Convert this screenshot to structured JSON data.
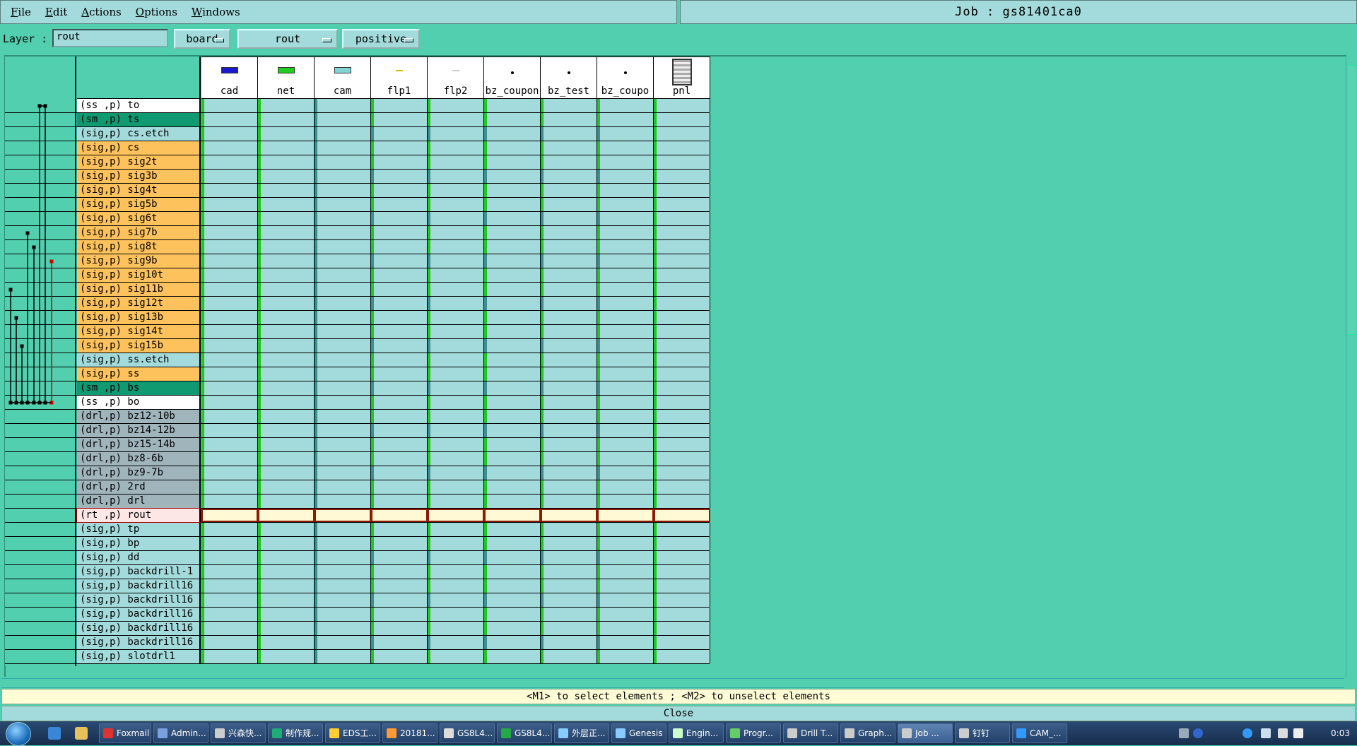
{
  "menu": [
    "File",
    "Edit",
    "Actions",
    "Options",
    "Windows"
  ],
  "job_title": "Job : gs81401ca0",
  "layer_label": "Layer :",
  "layer_value": "rout",
  "options": [
    "board",
    "rout",
    "positive"
  ],
  "steps": [
    "cad",
    "net",
    "cam",
    "flp1",
    "flp2",
    "bz_coupon",
    "bz_test",
    "bz_coupo",
    "pnl"
  ],
  "step_icon_colors": [
    "#1a1acc",
    "#22cc22",
    "#7fd4d4",
    "#d8c000",
    "#cccccc",
    "#000000",
    "#000000",
    "#000000",
    "#555555"
  ],
  "layers": [
    {
      "text": "(ss ,p) to",
      "color": "#ffffff"
    },
    {
      "text": "(sm ,p) ts",
      "color": "#0f9a72"
    },
    {
      "text": "(sig,p) cs.etch",
      "color": "#a3dadb"
    },
    {
      "text": "(sig,p) cs",
      "color": "#fec25c"
    },
    {
      "text": "(sig,p) sig2t",
      "color": "#fec25c"
    },
    {
      "text": "(sig,p) sig3b",
      "color": "#fec25c"
    },
    {
      "text": "(sig,p) sig4t",
      "color": "#fec25c"
    },
    {
      "text": "(sig,p) sig5b",
      "color": "#fec25c"
    },
    {
      "text": "(sig,p) sig6t",
      "color": "#fec25c"
    },
    {
      "text": "(sig,p) sig7b",
      "color": "#fec25c"
    },
    {
      "text": "(sig,p) sig8t",
      "color": "#fec25c"
    },
    {
      "text": "(sig,p) sig9b",
      "color": "#fec25c"
    },
    {
      "text": "(sig,p) sig10t",
      "color": "#fec25c"
    },
    {
      "text": "(sig,p) sig11b",
      "color": "#fec25c"
    },
    {
      "text": "(sig,p) sig12t",
      "color": "#fec25c"
    },
    {
      "text": "(sig,p) sig13b",
      "color": "#fec25c"
    },
    {
      "text": "(sig,p) sig14t",
      "color": "#fec25c"
    },
    {
      "text": "(sig,p) sig15b",
      "color": "#fec25c"
    },
    {
      "text": "(sig,p) ss.etch",
      "color": "#a3dadb"
    },
    {
      "text": "(sig,p) ss",
      "color": "#fec25c"
    },
    {
      "text": "(sm ,p) bs",
      "color": "#0f9a72"
    },
    {
      "text": "(ss ,p) bo",
      "color": "#ffffff"
    },
    {
      "text": "(drl,p) bz12-10b",
      "color": "#a0b4bc"
    },
    {
      "text": "(drl,p) bz14-12b",
      "color": "#a0b4bc"
    },
    {
      "text": "(drl,p) bz15-14b",
      "color": "#a0b4bc"
    },
    {
      "text": "(drl,p) bz8-6b",
      "color": "#a0b4bc"
    },
    {
      "text": "(drl,p) bz9-7b",
      "color": "#a0b4bc"
    },
    {
      "text": "(drl,p) 2rd",
      "color": "#a0b4bc"
    },
    {
      "text": "(drl,p) drl",
      "color": "#a0b4bc"
    },
    {
      "text": "(rt ,p) rout",
      "color": "#fde6e6"
    },
    {
      "text": "(sig,p) tp",
      "color": "#a3dadb"
    },
    {
      "text": "(sig,p) bp",
      "color": "#a3dadb"
    },
    {
      "text": "(sig,p) dd",
      "color": "#a3dadb"
    },
    {
      "text": "(sig,p) backdrill-1",
      "color": "#a3dadb"
    },
    {
      "text": "(sig,p) backdrill16",
      "color": "#a3dadb"
    },
    {
      "text": "(sig,p) backdrill16",
      "color": "#a3dadb"
    },
    {
      "text": "(sig,p) backdrill16",
      "color": "#a3dadb"
    },
    {
      "text": "(sig,p) backdrill16",
      "color": "#a3dadb"
    },
    {
      "text": "(sig,p) backdrill16",
      "color": "#a3dadb"
    },
    {
      "text": "(sig,p) slotdrl1",
      "color": "#a3dadb"
    }
  ],
  "selected_layer": "rout",
  "message": "<M1> to select elements ; <M2> to unselect elements",
  "close_label": "Close",
  "taskbar": {
    "items": [
      "Foxmail",
      "Admin...",
      "兴森快...",
      "制作规...",
      "EDS工...",
      "20181...",
      "GS8L4...",
      "GS8L4...",
      "外层正...",
      "Genesis",
      "Engin...",
      "Progr...",
      "Drill T...",
      "Graph...",
      "Job ...",
      "钉钉",
      "CAM_..."
    ],
    "clock": "0:03"
  }
}
